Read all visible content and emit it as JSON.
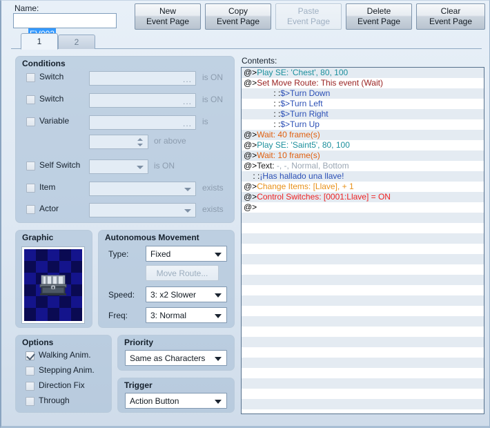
{
  "window": {
    "name_label": "Name:",
    "name_value": "EV002",
    "contents_label": "Contents:"
  },
  "toolbar": {
    "buttons": [
      {
        "line1": "New",
        "line2": "Event Page",
        "disabled": false
      },
      {
        "line1": "Copy",
        "line2": "Event Page",
        "disabled": false
      },
      {
        "line1": "Paste",
        "line2": "Event Page",
        "disabled": true
      },
      {
        "line1": "Delete",
        "line2": "Event Page",
        "disabled": false
      },
      {
        "line1": "Clear",
        "line2": "Event Page",
        "disabled": false
      }
    ]
  },
  "tabs": [
    {
      "label": "1",
      "active": true
    },
    {
      "label": "2",
      "active": false
    }
  ],
  "conditions": {
    "title": "Conditions",
    "rows": [
      {
        "label": "Switch",
        "checked": false,
        "suffix": "is ON"
      },
      {
        "label": "Switch",
        "checked": false,
        "suffix": "is ON"
      },
      {
        "label": "Variable",
        "checked": false,
        "suffix": "is"
      },
      {
        "label": "",
        "checked": null,
        "suffix": "or above"
      },
      {
        "label": "Self Switch",
        "checked": false,
        "suffix": "is ON"
      },
      {
        "label": "Item",
        "checked": false,
        "suffix": "exists"
      },
      {
        "label": "Actor",
        "checked": false,
        "suffix": "exists"
      }
    ]
  },
  "graphic": {
    "title": "Graphic",
    "sprite": "treasure-chest"
  },
  "autonomous": {
    "title": "Autonomous Movement",
    "type_label": "Type:",
    "type_value": "Fixed",
    "move_route_label": "Move Route...",
    "move_route_disabled": true,
    "speed_label": "Speed:",
    "speed_value": "3: x2 Slower",
    "freq_label": "Freq:",
    "freq_value": "3: Normal"
  },
  "options": {
    "title": "Options",
    "items": [
      {
        "label": "Walking Anim.",
        "checked": true
      },
      {
        "label": "Stepping Anim.",
        "checked": false
      },
      {
        "label": "Direction Fix",
        "checked": false
      },
      {
        "label": "Through",
        "checked": false
      }
    ]
  },
  "priority": {
    "title": "Priority",
    "value": "Same as Characters"
  },
  "trigger": {
    "title": "Trigger",
    "value": "Action Button"
  },
  "colors": {
    "play_se": "#1b8f9c",
    "move_route": "#992222",
    "move_step": "#2b4fb5",
    "wait": "#e06010",
    "text_cmd": "#1a1a1a",
    "text_params": "#9aa6b3",
    "text_message": "#2b4fb5",
    "change_items": "#e8911a",
    "control_switches": "#ee2222",
    "marker": "#000000"
  },
  "contents": {
    "lines": [
      {
        "marker": "@>",
        "indent": "",
        "segments": [
          {
            "t": "Play SE: 'Chest', 80, 100",
            "c": "#1b8f9c"
          }
        ]
      },
      {
        "marker": "@>",
        "indent": "",
        "segments": [
          {
            "t": "Set Move Route: This event (Wait)",
            "c": "#992222"
          }
        ]
      },
      {
        "marker": ":",
        "indent": "             : ",
        "segments": [
          {
            "t": "$>Turn Down",
            "c": "#2b4fb5"
          }
        ]
      },
      {
        "marker": ":",
        "indent": "             : ",
        "segments": [
          {
            "t": "$>Turn Left",
            "c": "#2b4fb5"
          }
        ]
      },
      {
        "marker": ":",
        "indent": "             : ",
        "segments": [
          {
            "t": "$>Turn Right",
            "c": "#2b4fb5"
          }
        ]
      },
      {
        "marker": ":",
        "indent": "             : ",
        "segments": [
          {
            "t": "$>Turn Up",
            "c": "#2b4fb5"
          }
        ]
      },
      {
        "marker": "@>",
        "indent": "",
        "segments": [
          {
            "t": "Wait: 40 frame(s)",
            "c": "#e06010"
          }
        ]
      },
      {
        "marker": "@>",
        "indent": "",
        "segments": [
          {
            "t": "Play SE: 'Saint5', 80, 100",
            "c": "#1b8f9c"
          }
        ]
      },
      {
        "marker": "@>",
        "indent": "",
        "segments": [
          {
            "t": "Wait: 10 frame(s)",
            "c": "#e06010"
          }
        ]
      },
      {
        "marker": "@>",
        "indent": "",
        "segments": [
          {
            "t": "Text: ",
            "c": "#1a1a1a"
          },
          {
            "t": "-, -, Normal, Bottom",
            "c": "#9aa6b3"
          }
        ]
      },
      {
        "marker": ":",
        "indent": "    : ",
        "segments": [
          {
            "t": "¡Has hallado una llave!",
            "c": "#2b4fb5"
          }
        ]
      },
      {
        "marker": "@>",
        "indent": "",
        "segments": [
          {
            "t": "Change Items: [Llave], + 1",
            "c": "#e8911a"
          }
        ]
      },
      {
        "marker": "@>",
        "indent": "",
        "segments": [
          {
            "t": "Control Switches: [0001:Llave] = ON",
            "c": "#ee2222"
          }
        ]
      },
      {
        "marker": "@>",
        "indent": "",
        "segments": []
      }
    ],
    "total_rows": 34
  }
}
